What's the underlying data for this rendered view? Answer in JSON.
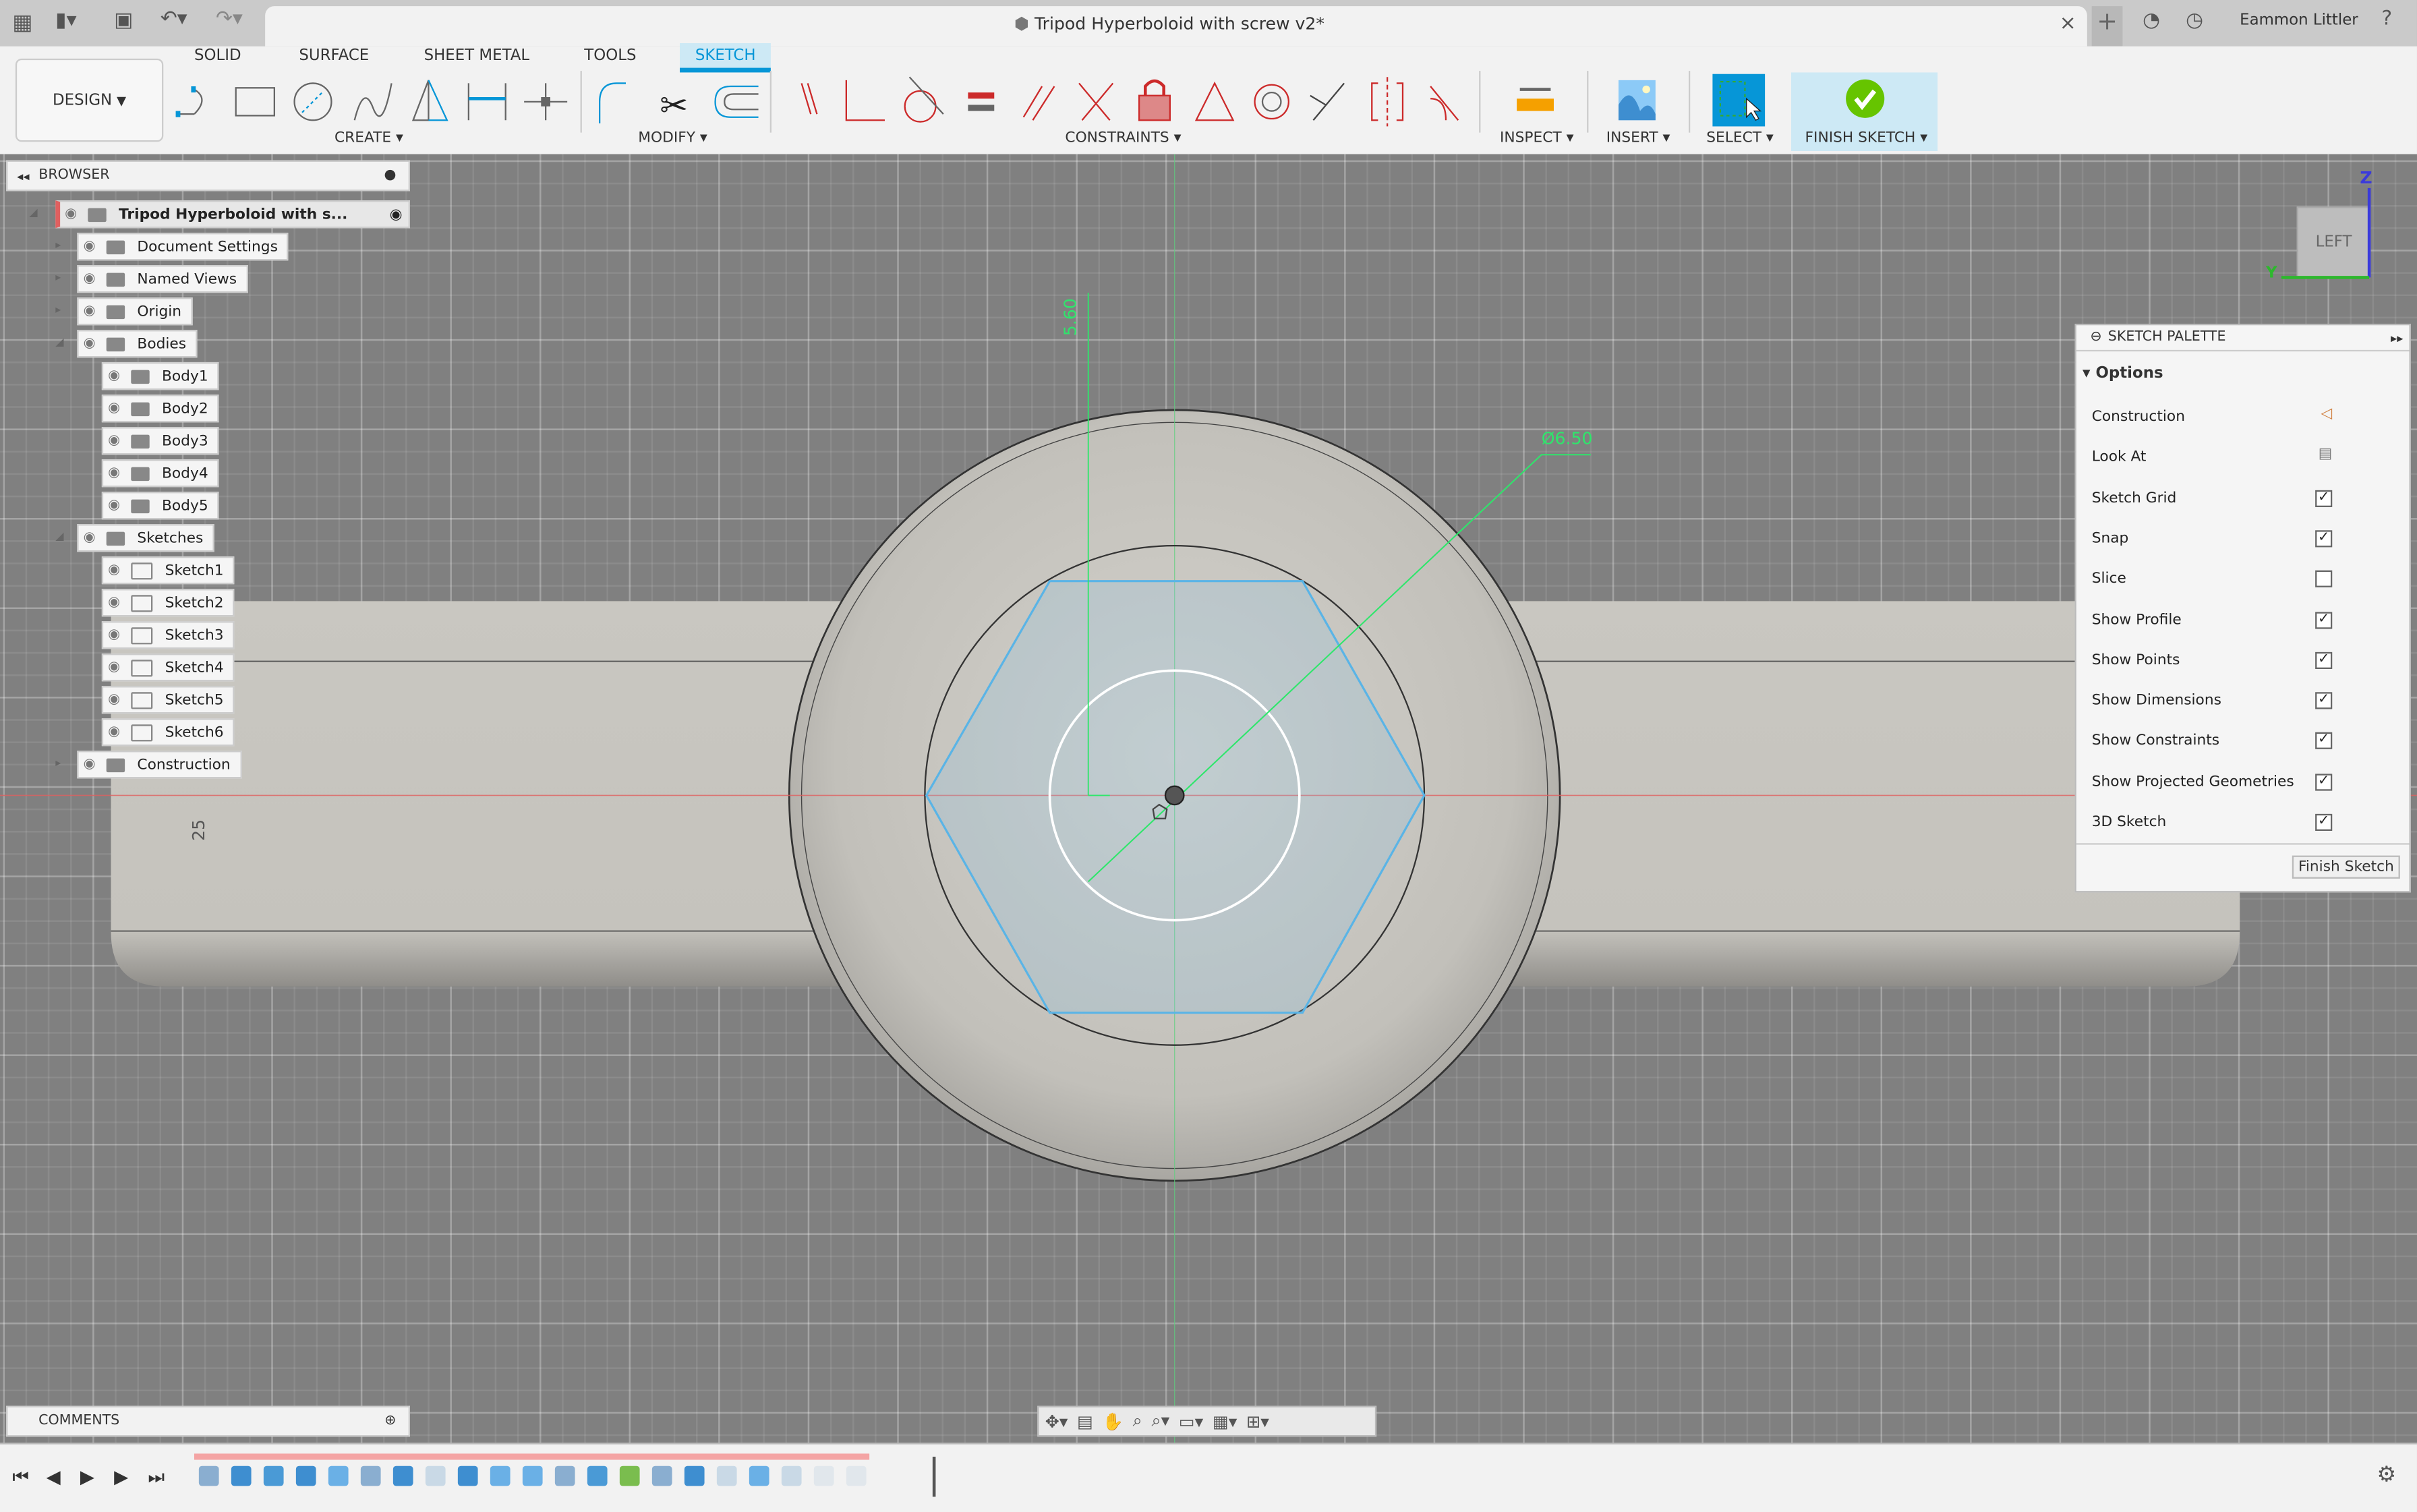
{
  "window": {
    "title": "Tripod Hyperboloid with screw v2*",
    "user": "Eammon Littler"
  },
  "workspace": {
    "label": "DESIGN"
  },
  "tabs": [
    {
      "label": "SOLID"
    },
    {
      "label": "SURFACE"
    },
    {
      "label": "SHEET METAL"
    },
    {
      "label": "TOOLS"
    },
    {
      "label": "SKETCH",
      "active": true
    }
  ],
  "toolbar_groups": {
    "create": "CREATE",
    "modify": "MODIFY",
    "constraints": "CONSTRAINTS",
    "inspect": "INSPECT",
    "insert": "INSERT",
    "select": "SELECT",
    "finish": "FINISH SKETCH"
  },
  "browser": {
    "title": "BROWSER",
    "root": "Tripod Hyperboloid with s...",
    "items": [
      "Document Settings",
      "Named Views",
      "Origin",
      "Bodies",
      "Body1",
      "Body2",
      "Body3",
      "Body4",
      "Body5",
      "Sketches",
      "Sketch1",
      "Sketch2",
      "Sketch3",
      "Sketch4",
      "Sketch5",
      "Sketch6",
      "Construction"
    ]
  },
  "comments": {
    "title": "COMMENTS"
  },
  "viewcube": {
    "face": "LEFT",
    "axis_z": "Z",
    "axis_y": "Y"
  },
  "dimensions": {
    "vertical": "5.60",
    "diameter": "Ø6.50",
    "side": "25"
  },
  "palette": {
    "title": "SKETCH PALETTE",
    "section": "Options",
    "options": [
      {
        "label": "Construction",
        "type": "icon"
      },
      {
        "label": "Look At",
        "type": "icon"
      },
      {
        "label": "Sketch Grid",
        "checked": true
      },
      {
        "label": "Snap",
        "checked": true
      },
      {
        "label": "Slice",
        "checked": false
      },
      {
        "label": "Show Profile",
        "checked": true
      },
      {
        "label": "Show Points",
        "checked": true
      },
      {
        "label": "Show Dimensions",
        "checked": true
      },
      {
        "label": "Show Constraints",
        "checked": true
      },
      {
        "label": "Show Projected Geometries",
        "checked": true
      },
      {
        "label": "3D Sketch",
        "checked": true
      }
    ],
    "finish_button": "Finish Sketch"
  },
  "colors": {
    "accent": "#0696d7",
    "finish": "#66c400",
    "dimension": "#2ee66b",
    "sketch": "#5ab4e6",
    "constraint": "#cc2a2a"
  }
}
